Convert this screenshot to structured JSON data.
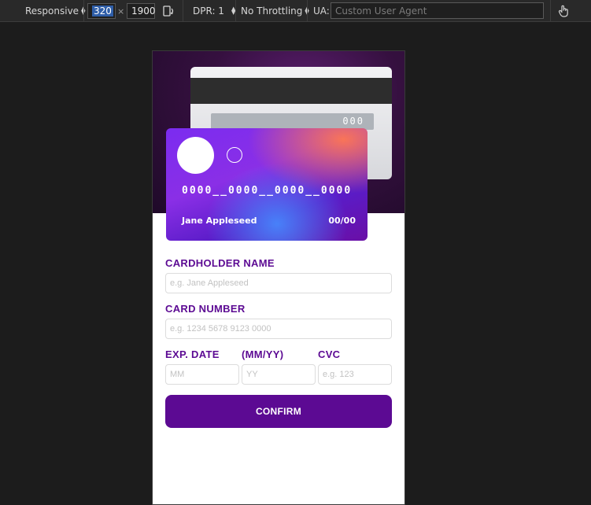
{
  "devtools": {
    "device_mode": "Responsive",
    "width": "320",
    "times": "×",
    "height": "1900",
    "dpr_label": "DPR: 1",
    "throttling": "No Throttling",
    "ua_label": "UA:",
    "ua_placeholder": "Custom User Agent"
  },
  "card_back": {
    "cvc": "000"
  },
  "card_front": {
    "number": "0000__0000__0000__0000",
    "name": "Jane Appleseed",
    "expiry": "00/00"
  },
  "form": {
    "cardholder_label": "CARDHOLDER NAME",
    "cardholder_placeholder": "e.g. Jane Appleseed",
    "number_label": "CARD NUMBER",
    "number_placeholder": "e.g. 1234 5678 9123 0000",
    "exp_label": "EXP. DATE",
    "exp_format_label": "(MM/YY)",
    "cvc_label": "CVC",
    "mm_placeholder": "MM",
    "yy_placeholder": "YY",
    "cvc_placeholder": "e.g. 123",
    "confirm_label": "CONFIRM"
  },
  "colors": {
    "accent": "#5c0a93",
    "toolbar_bg": "#292929",
    "page_bg": "#1c1c1c"
  }
}
